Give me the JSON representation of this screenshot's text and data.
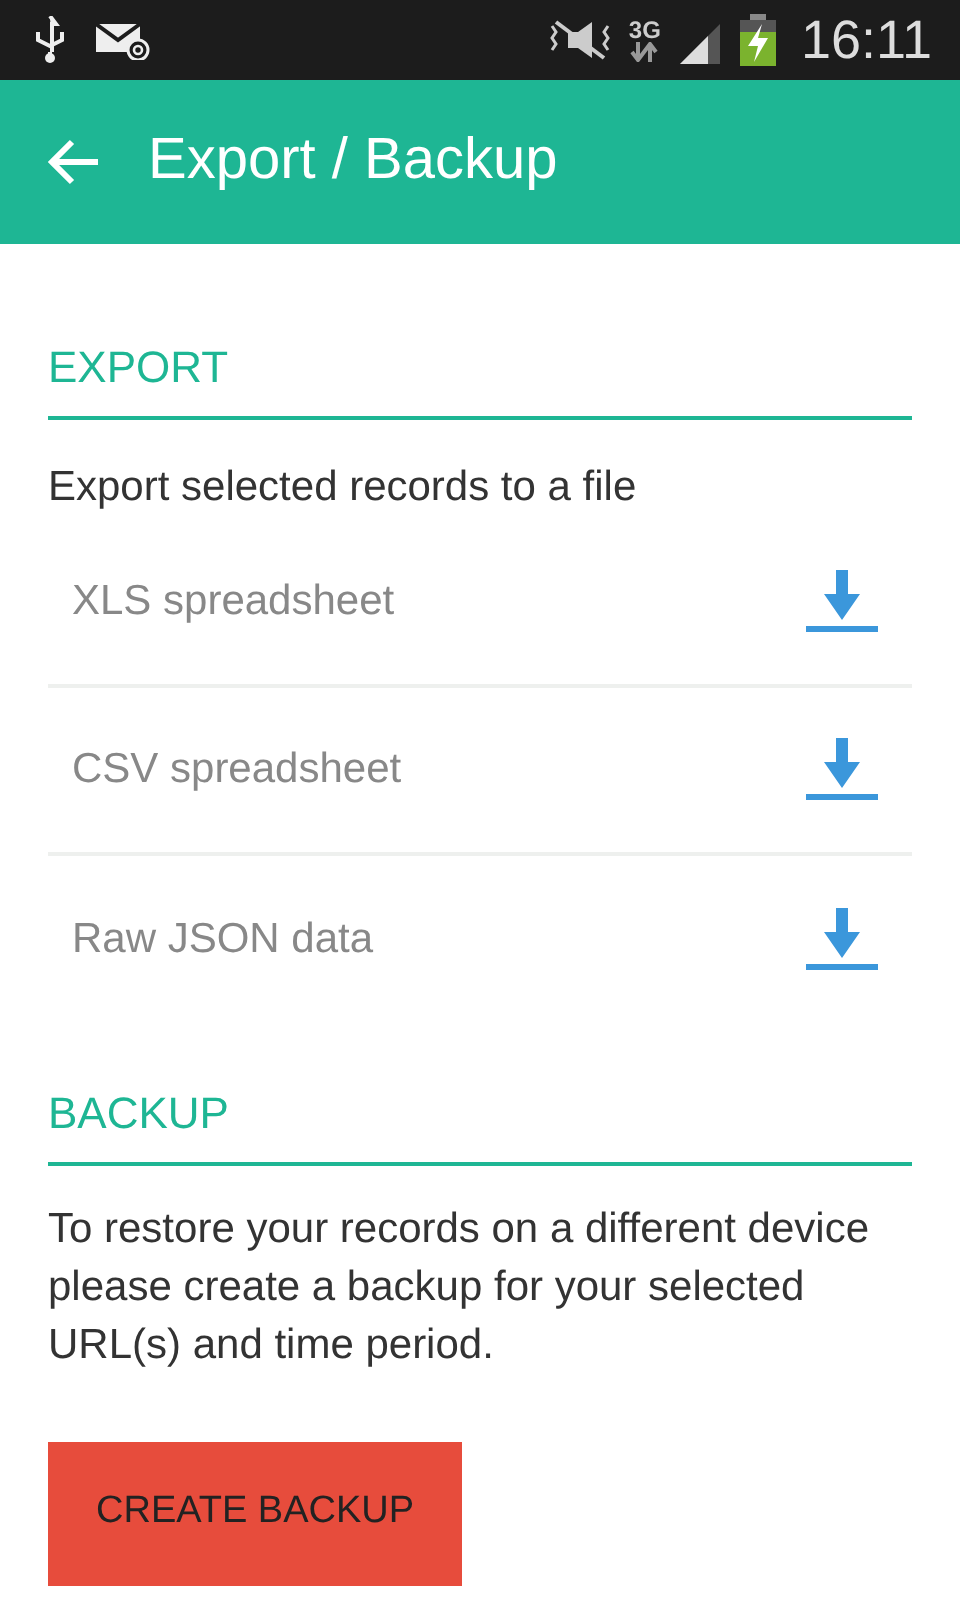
{
  "status_bar": {
    "network": "3G",
    "time": "16:11"
  },
  "app_bar": {
    "title": "Export / Backup"
  },
  "export": {
    "heading": "EXPORT",
    "subtitle": "Export selected records to a file",
    "items": [
      {
        "label": "XLS spreadsheet"
      },
      {
        "label": "CSV spreadsheet"
      },
      {
        "label": "Raw JSON data"
      }
    ]
  },
  "backup": {
    "heading": "BACKUP",
    "text": "To restore your records on a different device please create a backup for your selected URL(s) and time period.",
    "button": "CREATE BACKUP"
  }
}
